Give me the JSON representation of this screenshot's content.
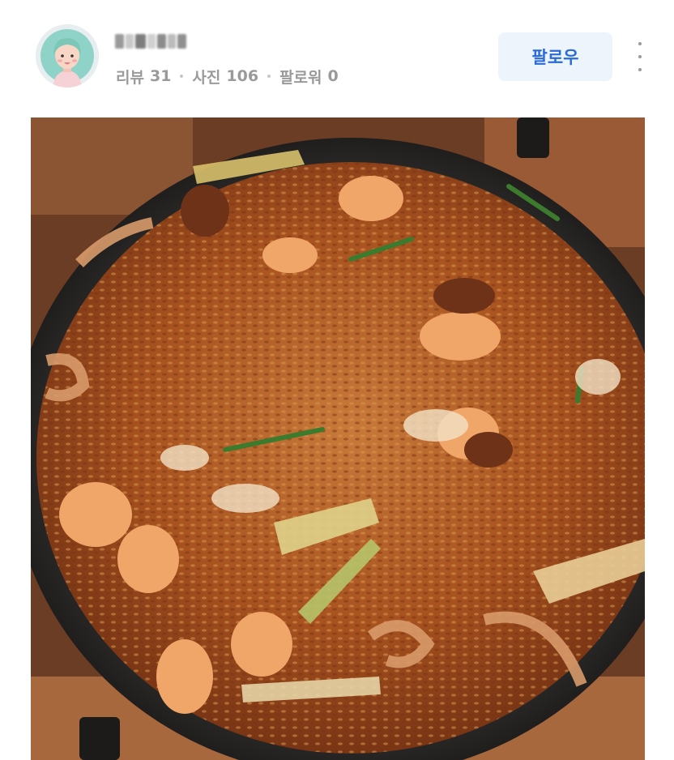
{
  "profile": {
    "avatar_icon": "cartoon-face-icon",
    "username": "",
    "stats": [
      {
        "label": "리뷰",
        "value": "31"
      },
      {
        "label": "사진",
        "value": "106"
      },
      {
        "label": "팔로워",
        "value": "0"
      }
    ]
  },
  "actions": {
    "follow_label": "팔로우",
    "more_icon": "more-vertical-icon"
  },
  "colors": {
    "accent": "#2a6bd8",
    "follow_bg": "#eef4fb",
    "stats_text": "#9a9a9a"
  }
}
